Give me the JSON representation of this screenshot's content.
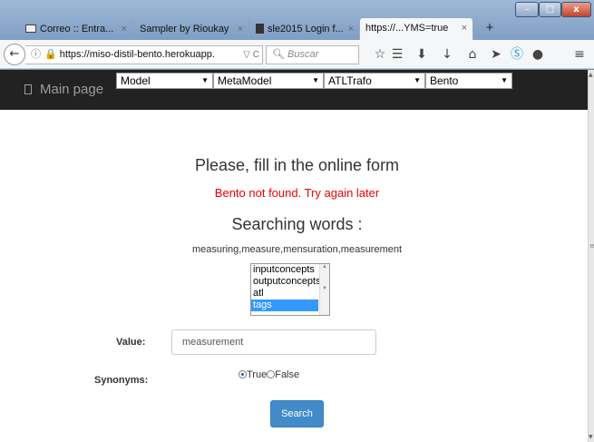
{
  "browser": {
    "tabs": [
      {
        "label": "Correo :: Entra...",
        "icon": "mail-icon"
      },
      {
        "label": "Sampler by Rioukay",
        "icon": ""
      },
      {
        "label": "sle2015 Login f...",
        "icon": "document-icon"
      },
      {
        "label": "https://...YMS=true",
        "icon": ""
      }
    ],
    "close_glyph": "×",
    "new_tab": "+",
    "url_host": "https://miso-distil-bento.herokuapp.",
    "url_extra": "▽ C",
    "search_placeholder": "Buscar",
    "window_buttons": {
      "minimize": "–",
      "maximize": "□",
      "close": "x"
    }
  },
  "site": {
    "brand": "Main page",
    "selects": [
      {
        "label": "Model"
      },
      {
        "label": "MetaModel"
      },
      {
        "label": "ATLTrafo"
      },
      {
        "label": "Bento"
      }
    ]
  },
  "form": {
    "title": "Please, fill in the online form",
    "error": "Bento not found. Try again later",
    "search_heading": "Searching words :",
    "words": "measuring,measure,mensuration,measurement",
    "list_options": [
      "inputconcepts",
      "outputconcepts",
      "atl",
      "tags"
    ],
    "selected_option": "tags",
    "value_label": "Value:",
    "value": "measurement",
    "synonyms_label": "Synonyms:",
    "synonyms_true": "True",
    "synonyms_false": "False",
    "synonyms_selected": "True",
    "search_button": "Search"
  },
  "colors": {
    "error": "#ee0000",
    "navbar": "#222222",
    "button": "#428bca"
  }
}
